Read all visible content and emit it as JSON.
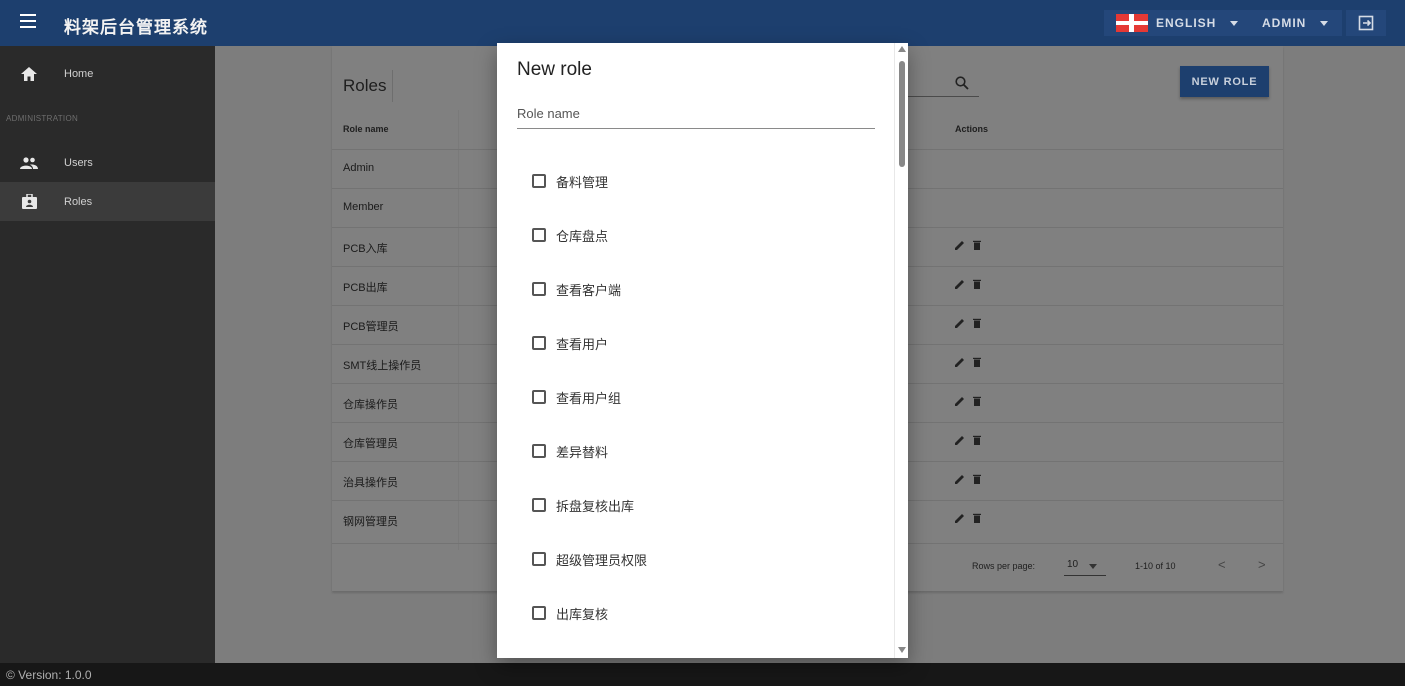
{
  "app": {
    "title": "料架后台管理系统"
  },
  "header": {
    "language_label": "ENGLISH",
    "user_label": "ADMIN"
  },
  "sidebar": {
    "section_label": "ADMINISTRATION",
    "items": [
      {
        "label": "Home",
        "icon": "home-icon",
        "active": false
      },
      {
        "label": "Users",
        "icon": "users-icon",
        "active": false
      },
      {
        "label": "Roles",
        "icon": "briefcase-icon",
        "active": true
      }
    ]
  },
  "main": {
    "title": "Roles",
    "new_role_label": "NEW ROLE",
    "columns": [
      "Role name",
      "Actions"
    ],
    "rows": [
      {
        "name": "Admin",
        "editable": false
      },
      {
        "name": "Member",
        "editable": false
      },
      {
        "name": "PCB入库",
        "editable": true
      },
      {
        "name": "PCB出库",
        "editable": true
      },
      {
        "name": "PCB管理员",
        "editable": true
      },
      {
        "name": "SMT线上操作员",
        "editable": true
      },
      {
        "name": "仓库操作员",
        "editable": true
      },
      {
        "name": "仓库管理员",
        "editable": true
      },
      {
        "name": "治具操作员",
        "editable": true
      },
      {
        "name": "钢网管理员",
        "editable": true
      }
    ],
    "pagination": {
      "rows_per_page_label": "Rows per page:",
      "rows_per_page": "10",
      "range": "1-10 of 10",
      "prev": "<",
      "next": ">"
    }
  },
  "dialog": {
    "title": "New role",
    "role_name_placeholder": "Role name",
    "permissions": [
      "备料管理",
      "仓库盘点",
      "查看客户端",
      "查看用户",
      "查看用户组",
      "差异替料",
      "拆盘复核出库",
      "超级管理员权限",
      "出库复核"
    ]
  },
  "footer": {
    "version": "© Version: 1.0.0"
  }
}
